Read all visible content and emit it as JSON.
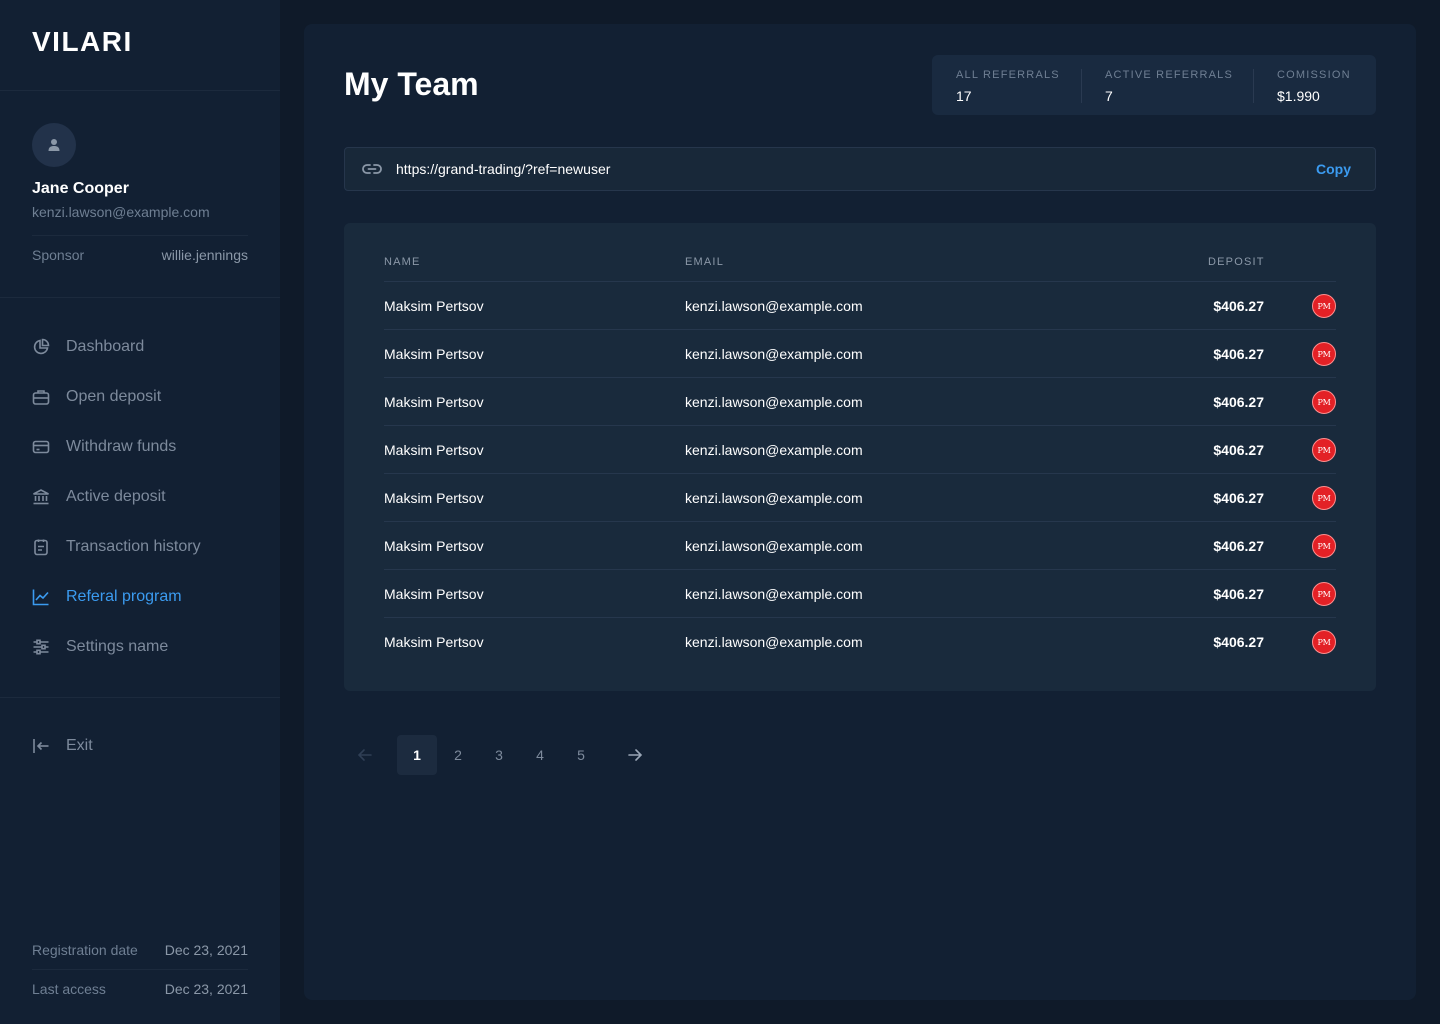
{
  "app": {
    "logo": "VILARI"
  },
  "user": {
    "name": "Jane Cooper",
    "email": "kenzi.lawson@example.com",
    "sponsor_label": "Sponsor",
    "sponsor_value": "willie.jennings"
  },
  "nav": {
    "items": [
      {
        "label": "Dashboard",
        "icon": "pie-chart-icon",
        "active": false
      },
      {
        "label": "Open deposit",
        "icon": "briefcase-icon",
        "active": false
      },
      {
        "label": "Withdraw funds",
        "icon": "credit-card-icon",
        "active": false
      },
      {
        "label": "Active deposit",
        "icon": "bank-icon",
        "active": false
      },
      {
        "label": "Transaction history",
        "icon": "clipboard-icon",
        "active": false
      },
      {
        "label": "Referal program",
        "icon": "trend-up-icon",
        "active": true
      },
      {
        "label": "Settings name",
        "icon": "sliders-icon",
        "active": false
      }
    ],
    "exit_label": "Exit"
  },
  "footer_info": {
    "registration_label": "Registration date",
    "registration_value": "Dec 23, 2021",
    "last_access_label": "Last access",
    "last_access_value": "Dec 23, 2021"
  },
  "main": {
    "title": "My Team",
    "stats": [
      {
        "label": "ALL REFERRALS",
        "value": "17"
      },
      {
        "label": "ACTIVE REFERRALS",
        "value": "7"
      },
      {
        "label": "COMISSION",
        "value": "$1.990"
      }
    ],
    "referral": {
      "url": "https://grand-trading/?ref=newuser",
      "copy_label": "Copy"
    },
    "table": {
      "headers": {
        "name": "NAME",
        "email": "EMAIL",
        "deposit": "DEPOSIT"
      },
      "badge_text": "PM",
      "rows": [
        {
          "name": "Maksim Pertsov",
          "email": "kenzi.lawson@example.com",
          "deposit": "$406.27"
        },
        {
          "name": "Maksim Pertsov",
          "email": "kenzi.lawson@example.com",
          "deposit": "$406.27"
        },
        {
          "name": "Maksim Pertsov",
          "email": "kenzi.lawson@example.com",
          "deposit": "$406.27"
        },
        {
          "name": "Maksim Pertsov",
          "email": "kenzi.lawson@example.com",
          "deposit": "$406.27"
        },
        {
          "name": "Maksim Pertsov",
          "email": "kenzi.lawson@example.com",
          "deposit": "$406.27"
        },
        {
          "name": "Maksim Pertsov",
          "email": "kenzi.lawson@example.com",
          "deposit": "$406.27"
        },
        {
          "name": "Maksim Pertsov",
          "email": "kenzi.lawson@example.com",
          "deposit": "$406.27"
        },
        {
          "name": "Maksim Pertsov",
          "email": "kenzi.lawson@example.com",
          "deposit": "$406.27"
        }
      ]
    },
    "pagination": {
      "pages": [
        "1",
        "2",
        "3",
        "4",
        "5"
      ],
      "current": "1"
    }
  },
  "colors": {
    "background": "#0f1a29",
    "panel": "#122033",
    "accent": "#3b9bf0",
    "badge": "#e32126"
  }
}
